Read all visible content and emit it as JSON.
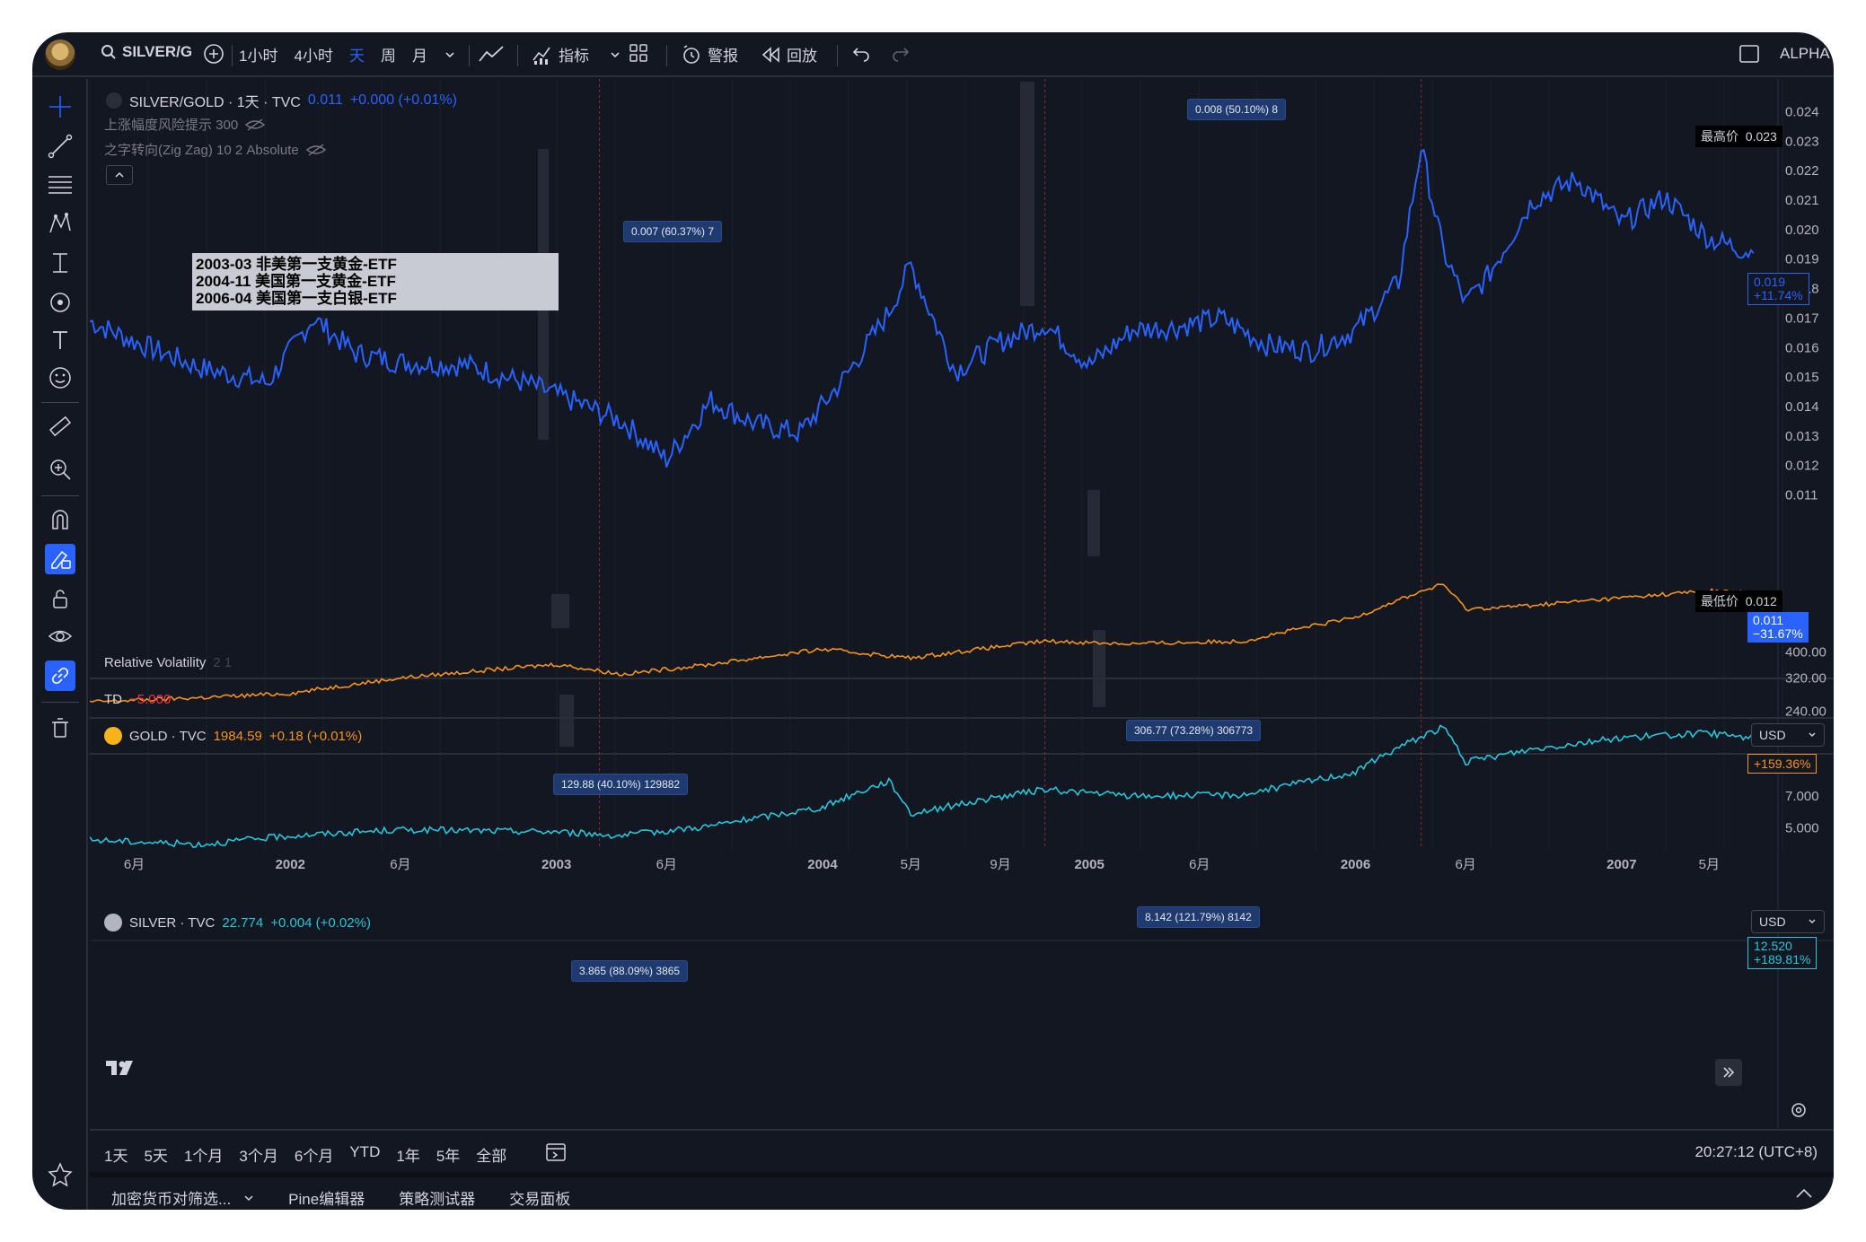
{
  "toolbar": {
    "symbol": "SILVER/G",
    "timeframes": [
      "1小时",
      "4小时",
      "天",
      "周",
      "月"
    ],
    "active_timeframe": "天",
    "indicators_label": "指标",
    "alert_label": "警报",
    "replay_label": "回放",
    "alpha_label": "ALPHA"
  },
  "main_pane": {
    "title": "SILVER/GOLD · 1天 · TVC",
    "value": "0.011",
    "change": "+0.000 (+0.01%)",
    "indicator1": "上涨幅度风险提示 300",
    "indicator2": "之字转向(Zig Zag) 10 2 Absolute",
    "note_lines": [
      "2003-03 非美第一支黄金-ETF",
      "2004-11 美国第一支黄金-ETF",
      "2006-04 美国第一支白银-ETF"
    ],
    "callouts": [
      "0.007 (60.37%) 7",
      "0.008 (50.10%) 8"
    ],
    "high_label": "最高价",
    "high_value": "0.023",
    "low_label": "最低价",
    "low_value": "0.012",
    "last_tag": [
      "0.019",
      "+11.74%"
    ],
    "last_tag2": [
      "0.011",
      "−31.67%"
    ]
  },
  "rv_pane": {
    "title": "Relative Volatility",
    "params": "2  1"
  },
  "td_pane": {
    "title": "TD",
    "value": "−5.000"
  },
  "gold_pane": {
    "title": "GOLD · TVC",
    "value": "1984.59",
    "change": "+0.18 (+0.01%)",
    "callouts": [
      "129.88 (40.10%) 129882",
      "306.77 (73.28%) 306773"
    ],
    "currency": "USD",
    "pct_tag": "+159.36%"
  },
  "silver_pane": {
    "title": "SILVER · TVC",
    "value": "22.774",
    "change": "+0.004 (+0.02%)",
    "callouts": [
      "3.865 (88.09%) 3865",
      "8.142 (121.79%) 8142"
    ],
    "currency": "USD",
    "pct_tag": "+189.81%",
    "pct_value_partial": "12.520"
  },
  "range_bar": {
    "items": [
      "1天",
      "5天",
      "1个月",
      "3个月",
      "6个月",
      "YTD",
      "1年",
      "5年",
      "全部"
    ],
    "clock": "20:27:12 (UTC+8)"
  },
  "bottom_tabs": [
    "加密货币对筛选...",
    "Pine编辑器",
    "策略测试器",
    "交易面板"
  ],
  "colors": {
    "background": "#131722",
    "ratio_line": "#2962ff",
    "gold_line": "#f7931a",
    "silver_line": "#26c6da",
    "callout_bg": "#1e3a6e",
    "highlight_band": "#2a2e39"
  },
  "icons": {
    "left_tools": [
      "crosshair-icon",
      "trendline-icon",
      "fib-icon",
      "pattern-icon",
      "measure-icon",
      "circle-icon",
      "text-icon",
      "emoji-icon",
      "ruler-icon",
      "zoom-in-icon",
      "magnet-icon",
      "lock-drawing-icon",
      "lock-icon",
      "eye-icon",
      "link-icon",
      "trash-icon"
    ]
  },
  "chart_data": [
    {
      "type": "line",
      "title": "SILVER/GOLD · 1天 · TVC",
      "x_tick_labels": [
        "6月",
        "2002",
        "6月",
        "2003",
        "6月",
        "2004",
        "5月",
        "9月",
        "2005",
        "6月",
        "2006",
        "6月",
        "2007",
        "5月"
      ],
      "y_tick_labels": [
        "0.024",
        "0.023",
        "0.022",
        "0.021",
        "0.020",
        "0.019",
        "0.018",
        "0.017",
        "0.016",
        "0.015",
        "0.014",
        "0.013",
        "0.012",
        "0.011"
      ],
      "ylim": [
        0.0105,
        0.0245
      ],
      "x": [
        "2001-04",
        "2001-06",
        "2001-09",
        "2001-12",
        "2002-02",
        "2002-04",
        "2002-06",
        "2002-09",
        "2002-12",
        "2003-02",
        "2003-04",
        "2003-06",
        "2003-08",
        "2003-10",
        "2003-12",
        "2004-02",
        "2004-04",
        "2004-05",
        "2004-07",
        "2004-09",
        "2004-11",
        "2005-01",
        "2005-03",
        "2005-05",
        "2005-07",
        "2005-09",
        "2005-11",
        "2006-01",
        "2006-03",
        "2006-04",
        "2006-05",
        "2006-06",
        "2006-07",
        "2006-09",
        "2006-11",
        "2007-01",
        "2007-03",
        "2007-05",
        "2007-07"
      ],
      "series": [
        {
          "values": [
            0.0169,
            0.0162,
            0.0153,
            0.0148,
            0.017,
            0.0158,
            0.0155,
            0.0154,
            0.0147,
            0.0141,
            0.0135,
            0.0122,
            0.0142,
            0.0134,
            0.0131,
            0.015,
            0.0172,
            0.0188,
            0.0152,
            0.0162,
            0.0168,
            0.0154,
            0.0166,
            0.0167,
            0.017,
            0.0161,
            0.0159,
            0.0166,
            0.0182,
            0.0228,
            0.0193,
            0.0175,
            0.0184,
            0.021,
            0.0217,
            0.0202,
            0.0211,
            0.0197,
            0.0192
          ]
        }
      ]
    },
    {
      "type": "line",
      "title": "GOLD · TVC",
      "y_tick_labels": [
        "400.00",
        "320.00",
        "240.00"
      ],
      "x": [
        "2001-04",
        "2001-09",
        "2002-01",
        "2002-06",
        "2003-01",
        "2003-04",
        "2003-08",
        "2004-01",
        "2004-05",
        "2004-11",
        "2005-03",
        "2005-08",
        "2006-01",
        "2006-05",
        "2006-06",
        "2006-09",
        "2007-01",
        "2007-05",
        "2007-07"
      ],
      "series": [
        {
          "values": [
            260,
            270,
            280,
            320,
            360,
            330,
            360,
            410,
            380,
            440,
            430,
            440,
            540,
            720,
            580,
            600,
            640,
            680,
            665
          ]
        }
      ]
    },
    {
      "type": "line",
      "title": "SILVER · TVC",
      "y_tick_labels": [
        "12.520",
        "7.000",
        "5.000"
      ],
      "x": [
        "2001-04",
        "2001-09",
        "2002-01",
        "2002-06",
        "2003-01",
        "2003-04",
        "2003-08",
        "2004-01",
        "2004-04",
        "2004-05",
        "2004-11",
        "2005-03",
        "2005-08",
        "2006-01",
        "2006-05",
        "2006-06",
        "2006-09",
        "2007-01",
        "2007-05",
        "2007-07"
      ],
      "series": [
        {
          "values": [
            4.4,
            4.2,
            4.6,
            4.9,
            4.8,
            4.6,
            5.1,
            6.2,
            8.2,
            5.8,
            7.5,
            7.0,
            7.1,
            9.0,
            14.5,
            10.0,
            11.5,
            13.0,
            13.6,
            12.9
          ]
        }
      ]
    }
  ]
}
